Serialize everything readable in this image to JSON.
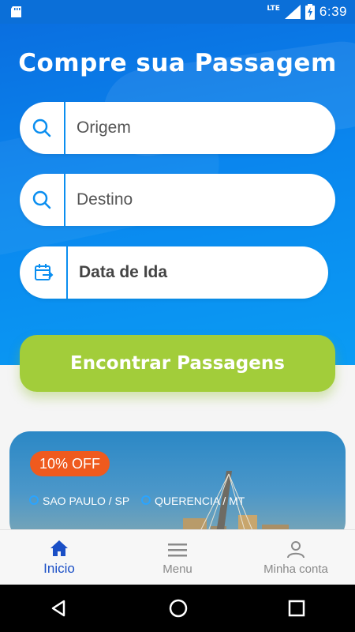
{
  "status_bar": {
    "time": "6:39",
    "network": "LTE"
  },
  "hero": {
    "title": "Compre sua Passagem"
  },
  "fields": {
    "origin": {
      "label": "Origem",
      "icon": "search-icon"
    },
    "destination": {
      "label": "Destino",
      "icon": "search-icon"
    },
    "date": {
      "label": "Data de Ida",
      "icon": "calendar-icon"
    }
  },
  "cta": {
    "label": "Encontrar Passagens"
  },
  "promo": {
    "badge": "10% OFF",
    "from": "SAO PAULO / SP",
    "to": "QUERENCIA / MT"
  },
  "bottom_nav": [
    {
      "label": "Inicio",
      "icon": "home-icon",
      "active": true
    },
    {
      "label": "Menu",
      "icon": "menu-icon",
      "active": false
    },
    {
      "label": "Minha conta",
      "icon": "user-icon",
      "active": false
    }
  ],
  "colors": {
    "primary": "#0a86ee",
    "accent": "#a2cd3a",
    "badge": "#ef5a1e",
    "active_nav": "#1a4fc6"
  }
}
